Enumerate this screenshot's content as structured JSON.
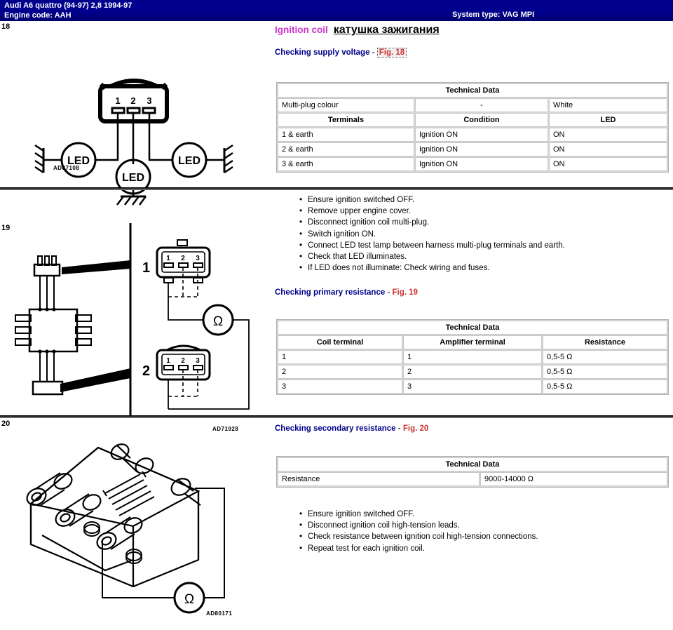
{
  "header": {
    "vehicle": "Audi   A6 quattro (94-97) 2,8  1994-97",
    "engine_code": "Engine code: AAH",
    "system_type": "System type: VAG MPI",
    "bar_color": "#00008b"
  },
  "title": {
    "english": "Ignition coil",
    "russian": "катушка зажигания",
    "english_color": "#cc33cc"
  },
  "sections": [
    {
      "fig_number": "18",
      "heading": "Checking supply voltage",
      "heading_dash": "-",
      "fig_label": "Fig. 18",
      "diagram_code": "AD87108",
      "connector_terminals": [
        "1",
        "2",
        "3"
      ],
      "led_labels": [
        "LED",
        "LED",
        "LED"
      ],
      "table": {
        "title": "Technical Data",
        "rows": [
          [
            "Multi-plug colour",
            "-",
            "White"
          ]
        ],
        "column_headers": [
          "Terminals",
          "Condition",
          "LED"
        ],
        "data_rows": [
          [
            "1 & earth",
            "Ignition ON",
            "ON"
          ],
          [
            "2 & earth",
            "Ignition ON",
            "ON"
          ],
          [
            "3 & earth",
            "Ignition ON",
            "ON"
          ]
        ]
      },
      "steps": [
        "Ensure ignition switched OFF.",
        "Remove upper engine cover.",
        "Disconnect ignition coil multi-plug.",
        "Switch ignition ON.",
        "Connect LED test lamp between harness multi-plug terminals and earth.",
        "Check that LED illuminates.",
        "If LED does not illuminate: Check wiring and fuses."
      ]
    },
    {
      "fig_number": "19",
      "heading": "Checking primary resistance",
      "heading_dash": "-",
      "fig_label": "Fig. 19",
      "diagram_code": "AD71928",
      "callouts": [
        "1",
        "2"
      ],
      "connector_terminals": [
        "1",
        "2",
        "3"
      ],
      "meter_symbol": "Ω",
      "table": {
        "title": "Technical Data",
        "column_headers": [
          "Coil terminal",
          "Amplifier terminal",
          "Resistance"
        ],
        "data_rows": [
          [
            "1",
            "1",
            "0,5-5 Ω"
          ],
          [
            "2",
            "2",
            "0,5-5 Ω"
          ],
          [
            "3",
            "3",
            "0,5-5 Ω"
          ]
        ]
      }
    },
    {
      "fig_number": "20",
      "heading": "Checking secondary resistance",
      "heading_dash": "-",
      "fig_label": "Fig. 20",
      "diagram_code": "AD80171",
      "meter_symbol": "Ω",
      "table": {
        "title": "Technical Data",
        "data_rows": [
          [
            "Resistance",
            "9000-14000 Ω"
          ]
        ]
      },
      "steps": [
        "Ensure ignition switched OFF.",
        "Disconnect ignition coil high-tension leads.",
        "Check resistance between ignition coil high-tension connections.",
        "Repeat test for each ignition coil."
      ]
    }
  ]
}
